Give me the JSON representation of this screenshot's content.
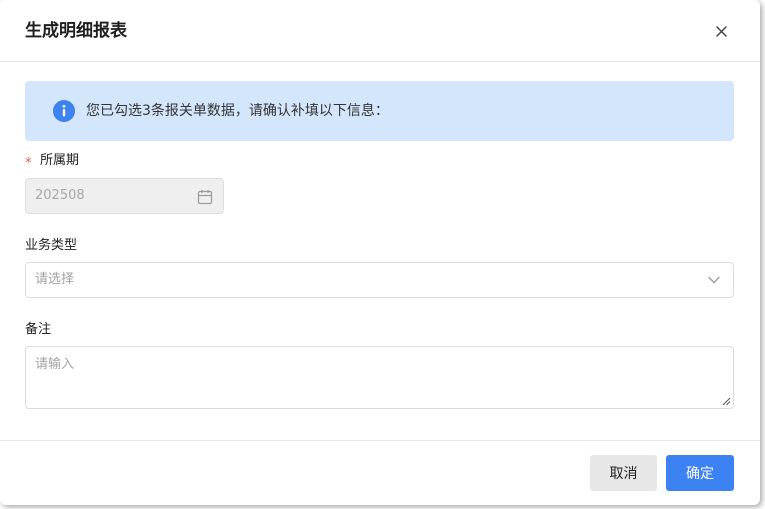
{
  "dialog": {
    "title": "生成明细报表",
    "close_icon": "close-icon"
  },
  "alert": {
    "icon": "info-icon",
    "text": "您已勾选3条报关单数据，请确认补填以下信息："
  },
  "form": {
    "period": {
      "required_mark": "*",
      "label": "所属期",
      "value": "202508",
      "icon": "calendar-icon"
    },
    "business_type": {
      "label": "业务类型",
      "placeholder": "请选择",
      "icon": "chevron-down-icon"
    },
    "remark": {
      "label": "备注",
      "placeholder": "请输入",
      "icon": "resize-handle-icon"
    }
  },
  "footer": {
    "cancel_label": "取消",
    "ok_label": "确定"
  },
  "colors": {
    "primary": "#3d82f3",
    "alert_bg": "#d4e6fb",
    "required": "#e05a5a"
  }
}
